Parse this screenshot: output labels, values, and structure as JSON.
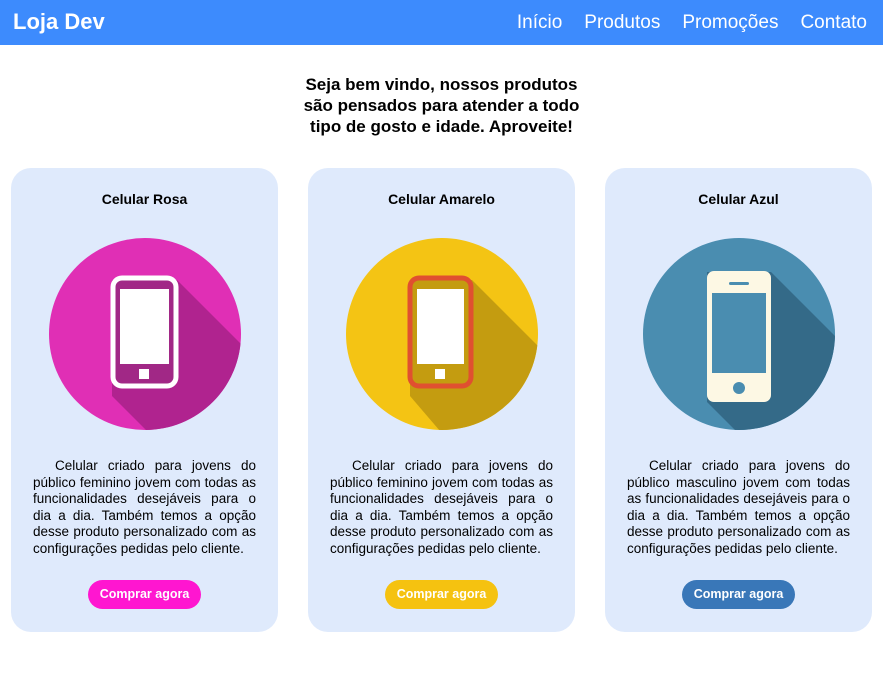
{
  "header": {
    "brand": "Loja Dev",
    "nav": [
      "Início",
      "Produtos",
      "Promoções",
      "Contato"
    ],
    "background_color": "#3d8bfd"
  },
  "intro": {
    "text": "Seja bem vindo, nossos produtos são pensados para atender a todo tipo de gosto e idade. Aproveite!"
  },
  "products": [
    {
      "title": "Celular Rosa",
      "description": "Celular criado para jovens do público feminino jovem com todas as funcionalidades desejáveis para o dia a dia. Também temos a opção desse produto personalizado com as configurações pedidas pelo cliente.",
      "button": "Comprar agora",
      "button_color": "#ff16d0",
      "icon": "phone-icon",
      "icon_circle_color": "#e02fb5",
      "icon_shadow_color": "#b0238f",
      "icon_frame_color": "#a12886"
    },
    {
      "title": "Celular Amarelo",
      "description": "Celular criado para jovens do público feminino jovem com todas as funcionalidades desejáveis para o dia a dia. Também temos a opção desse produto personalizado com as configurações pedidas pelo cliente.",
      "button": "Comprar agora",
      "button_color": "#f5c210",
      "icon": "phone-icon",
      "icon_circle_color": "#f4c414",
      "icon_shadow_color": "#c49c10",
      "icon_frame_color": "#e05030"
    },
    {
      "title": "Celular Azul",
      "description": "Celular criado para jovens do público masculino jovem com todas as funcionalidades desejáveis para o dia a dia. Também temos a opção desse produto personalizado com as configurações pedidas pelo cliente.",
      "button": "Comprar agora",
      "button_color": "#3977b8",
      "icon": "phone-icon",
      "icon_circle_color": "#4a8db0",
      "icon_shadow_color": "#346a88",
      "icon_frame_color": "#fdf8e4"
    }
  ]
}
